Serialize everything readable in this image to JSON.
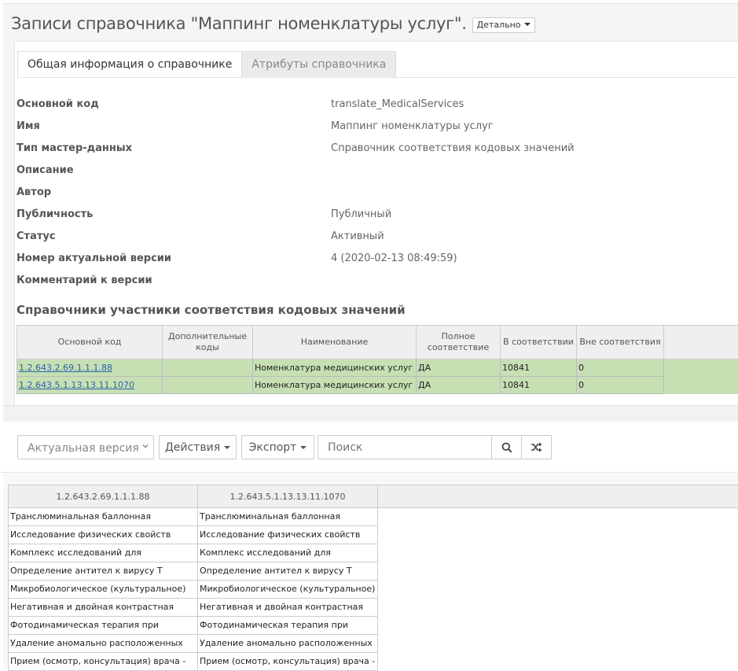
{
  "header": {
    "title": "Записи справочника \"Маппинг номенклатуры услуг\".",
    "detail_label": "Детально"
  },
  "tabs": [
    {
      "label": "Общая информация о справочнике",
      "active": true
    },
    {
      "label": "Атрибуты справочника",
      "active": false
    }
  ],
  "properties": [
    {
      "label": "Основной код",
      "value": "translate_MedicalServices"
    },
    {
      "label": "Имя",
      "value": "Маппинг номенклатуры услуг"
    },
    {
      "label": "Тип мастер-данных",
      "value": "Справочник соответствия кодовых значений"
    },
    {
      "label": "Описание",
      "value": ""
    },
    {
      "label": "Автор",
      "value": ""
    },
    {
      "label": "Публичность",
      "value": "Публичный"
    },
    {
      "label": "Статус",
      "value": "Активный"
    },
    {
      "label": "Номер актуальной версии",
      "value": "4 (2020-02-13 08:49:59)"
    },
    {
      "label": "Комментарий к версии",
      "value": ""
    }
  ],
  "participants": {
    "title": "Справочники участники соответствия кодовых значений",
    "columns": [
      "Основной код",
      "Дополнительные коды",
      "Наименование",
      "Полное соответствие",
      "В соответствии",
      "Вне соответствия"
    ],
    "rows": [
      {
        "code": "1.2.643.2.69.1.1.1.88",
        "extra": "",
        "name": "Номенклатура медицинских услуг",
        "full": "ДА",
        "in": "10841",
        "out": "0"
      },
      {
        "code": "1.2.643.5.1.13.13.11.1070",
        "extra": "",
        "name": "Номенклатура медицинских услуг",
        "full": "ДА",
        "in": "10841",
        "out": "0"
      }
    ]
  },
  "toolbar": {
    "version_select": "Актуальная версия",
    "actions_label": "Действия",
    "export_label": "Экспорт",
    "search_placeholder": "Поиск"
  },
  "records": {
    "columns": [
      "1.2.643.2.69.1.1.1.88",
      "1.2.643.5.1.13.13.11.1070"
    ],
    "rows": [
      [
        "Транслюминальная баллонная",
        "Транслюминальная баллонная"
      ],
      [
        "Исследование физических свойств",
        "Исследование физических свойств"
      ],
      [
        "Комплекс исследований для",
        "Комплекс исследований для"
      ],
      [
        "Определение антител к вирусу Т",
        "Определение антител к вирусу Т"
      ],
      [
        "Микробиологическое (культуральное)",
        "Микробиологическое (культуральное)"
      ],
      [
        "Негативная и двойная контрастная",
        "Негативная и двойная контрастная"
      ],
      [
        "Фотодинамическая терапия при",
        "Фотодинамическая терапия при"
      ],
      [
        "Удаление аномально расположенных",
        "Удаление аномально расположенных"
      ],
      [
        "Прием (осмотр, консультация) врача -",
        "Прием (осмотр, консультация) врача -"
      ]
    ]
  }
}
